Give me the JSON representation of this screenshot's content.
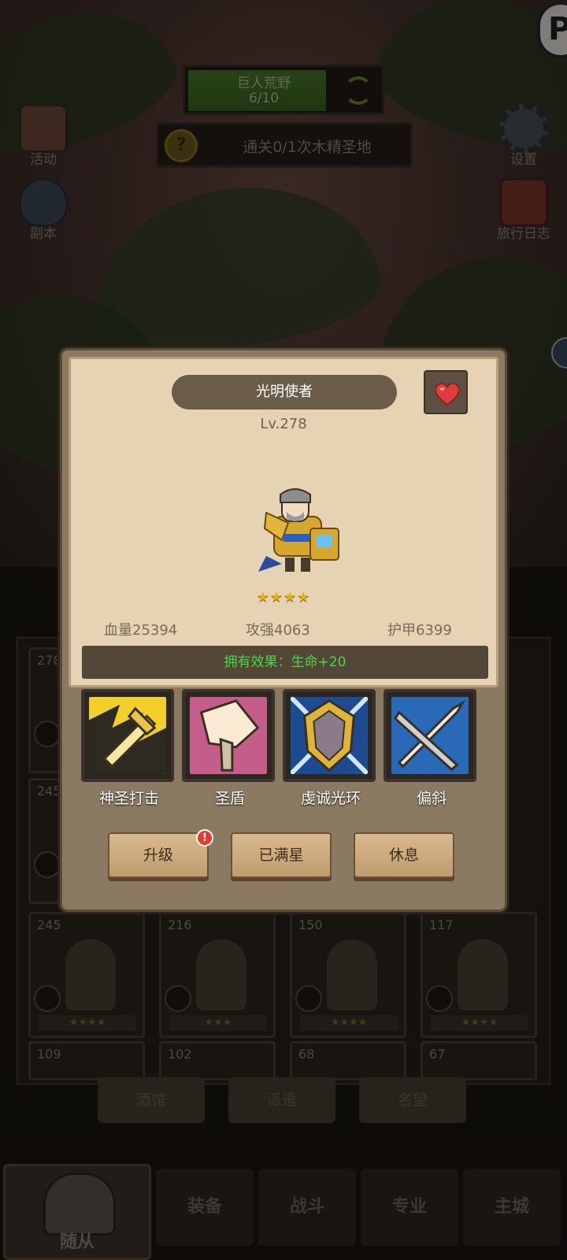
{
  "hud": {
    "zone_name": "巨人荒野",
    "zone_progress": "6/10",
    "quest_text": "通关0/1次木精圣地",
    "quest_icon": "?",
    "left_buttons": [
      {
        "label": "活动",
        "icon": "scroll-icon"
      },
      {
        "label": "副本",
        "icon": "portal-icon"
      }
    ],
    "right_buttons": [
      {
        "label": "设置",
        "icon": "gear-icon"
      },
      {
        "label": "旅行日志",
        "icon": "book-icon"
      }
    ],
    "corner_badge": "P"
  },
  "dialog": {
    "hero_name": "光明使者",
    "level": "Lv.278",
    "stars": "★★★★",
    "stats": {
      "hp": "血量25394",
      "attack": "攻强4063",
      "armor": "护甲6399"
    },
    "effect": "拥有效果：生命+20",
    "skills": [
      {
        "name": "神圣打击"
      },
      {
        "name": "圣盾"
      },
      {
        "name": "虔诚光环"
      },
      {
        "name": "偏斜"
      }
    ],
    "buttons": {
      "upgrade": "升级",
      "max_star": "已满星",
      "rest": "休息",
      "alert": "!"
    }
  },
  "roster": {
    "cards": [
      {
        "level": "278",
        "stars": "★★★★"
      },
      {
        "level": "245",
        "stars": "★★★★"
      },
      {
        "level": "245",
        "stars": "★★★★"
      },
      {
        "level": "216",
        "stars": "★★★"
      },
      {
        "level": "150",
        "stars": "★★★★"
      },
      {
        "level": "117",
        "stars": "★★★★"
      },
      {
        "level": "109",
        "stars": ""
      },
      {
        "level": "102",
        "stars": ""
      },
      {
        "level": "68",
        "stars": ""
      },
      {
        "level": "67",
        "stars": ""
      }
    ]
  },
  "sub_tabs": [
    "酒馆",
    "派遣",
    "名望"
  ],
  "nav": {
    "active": "随从",
    "items": [
      "装备",
      "战斗",
      "专业",
      "主城"
    ]
  },
  "colors": {
    "parchment": "#e6d3b3",
    "effect_text": "#43d94a",
    "star_gold": "#e4b018",
    "alert_red": "#e53a2e"
  }
}
